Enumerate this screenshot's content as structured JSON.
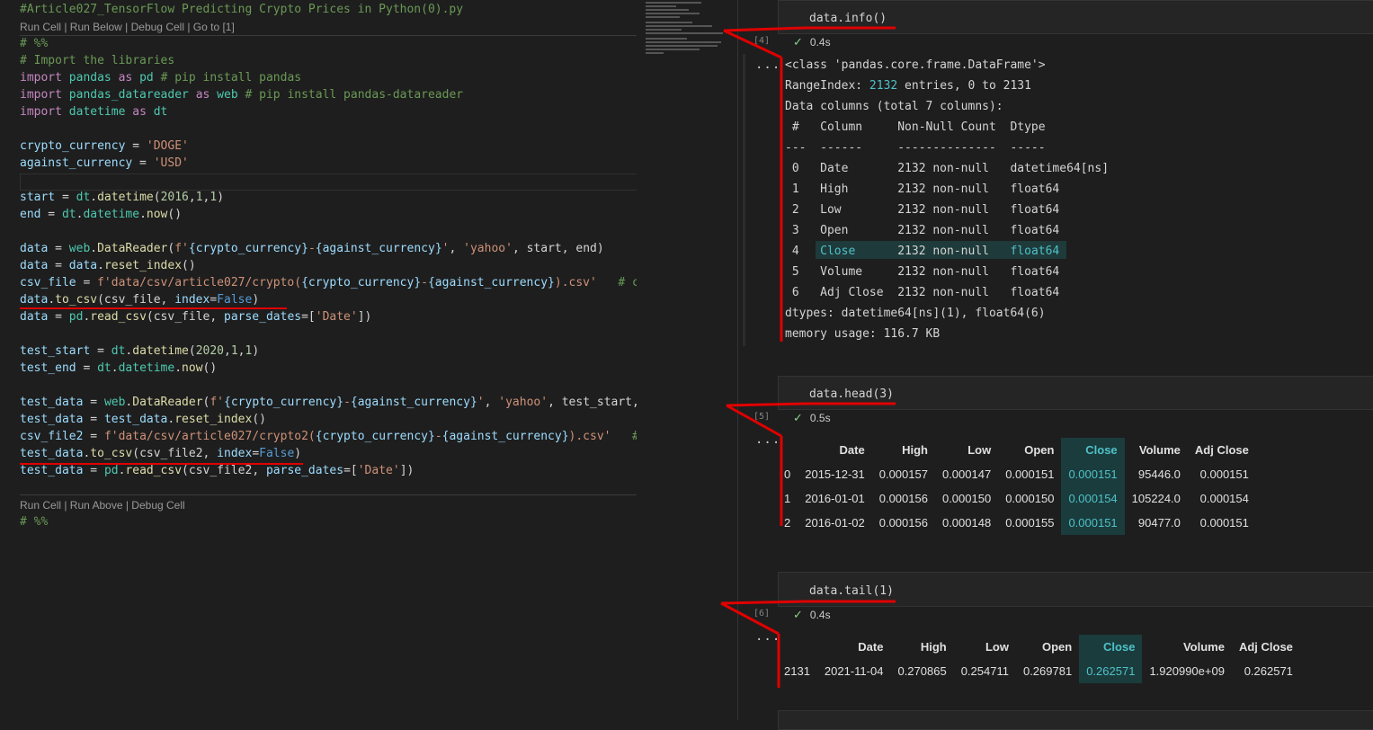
{
  "editor": {
    "title": "#Article027_TensorFlow Predicting Crypto Prices in Python(0).py",
    "codelens_top": "Run Cell | Run Below | Debug Cell | Go to [1]",
    "codelens_bottom": "Run Cell | Run Above | Debug Cell",
    "lines": {
      "l1": "# %%",
      "l2": "# Import the libraries",
      "l3a": "import",
      "l3b": " pandas ",
      "l3c": "as",
      "l3d": " pd ",
      "l3e": "# pip install pandas",
      "l4a": "import",
      "l4b": " pandas_datareader ",
      "l4c": "as",
      "l4d": " web ",
      "l4e": "# pip install pandas-datareader",
      "l5a": "import",
      "l5b": " datetime ",
      "l5c": "as",
      "l5d": " dt",
      "l6a": "crypto_currency",
      "l6b": " = ",
      "l6c": "'DOGE'",
      "l7a": "against_currency",
      "l7b": " = ",
      "l7c": "'USD'",
      "l8a": "start",
      "l8b": " = ",
      "l8c": "dt",
      "l8d": ".",
      "l8e": "datetime",
      "l8f": "(",
      "l8g": "2016",
      "l8h": ",",
      "l8i": "1",
      "l8j": ",",
      "l8k": "1",
      "l8l": ")",
      "l9a": "end",
      "l9b": " = ",
      "l9c": "dt",
      "l9d": ".",
      "l9e": "datetime",
      "l9f": ".",
      "l9g": "now",
      "l9h": "()",
      "l10a": "data",
      "l10b": " = ",
      "l10c": "web",
      "l10d": ".",
      "l10e": "DataReader",
      "l10f": "(",
      "l10g": "f'",
      "l10h": "{crypto_currency}",
      "l10i": "-",
      "l10j": "{against_currency}",
      "l10k": "'",
      "l10l": ", ",
      "l10m": "'yahoo'",
      "l10n": ", start, end)",
      "l11a": "data",
      "l11b": " = ",
      "l11c": "data",
      "l11d": ".",
      "l11e": "reset_index",
      "l11f": "()",
      "l12a": "csv_file",
      "l12b": " = ",
      "l12c": "f'data/csv/article027/crypto(",
      "l12d": "{crypto_currency}",
      "l12e": "-",
      "l12f": "{against_currency}",
      "l12g": ").csv'",
      "l12h": "   # cry",
      "l13a": "data",
      "l13b": ".",
      "l13c": "to_csv",
      "l13d": "(csv_file, ",
      "l13e": "index",
      "l13f": "=",
      "l13g": "False",
      "l13h": ")",
      "l14a": "data",
      "l14b": " = ",
      "l14c": "pd",
      "l14d": ".",
      "l14e": "read_csv",
      "l14f": "(csv_file, ",
      "l14g": "parse_dates",
      "l14h": "=[",
      "l14i": "'Date'",
      "l14j": "])",
      "l15a": "test_start",
      "l15b": " = ",
      "l15c": "dt",
      "l15d": ".",
      "l15e": "datetime",
      "l15f": "(",
      "l15g": "2020",
      "l15h": ",",
      "l15i": "1",
      "l15j": ",",
      "l15k": "1",
      "l15l": ")",
      "l16a": "test_end",
      "l16b": " = ",
      "l16c": "dt",
      "l16d": ".",
      "l16e": "datetime",
      "l16f": ".",
      "l16g": "now",
      "l16h": "()",
      "l17a": "test_data",
      "l17b": " = ",
      "l17c": "web",
      "l17d": ".",
      "l17e": "DataReader",
      "l17f": "(",
      "l17g": "f'",
      "l17h": "{crypto_currency}",
      "l17i": "-",
      "l17j": "{against_currency}",
      "l17k": "'",
      "l17l": ", ",
      "l17m": "'yahoo'",
      "l17n": ", test_start, t",
      "l18a": "test_data",
      "l18b": " = ",
      "l18c": "test_data",
      "l18d": ".",
      "l18e": "reset_index",
      "l18f": "()",
      "l19a": "csv_file2",
      "l19b": " = ",
      "l19c": "f'data/csv/article027/crypto2(",
      "l19d": "{crypto_currency}",
      "l19e": "-",
      "l19f": "{against_currency}",
      "l19g": ").csv'",
      "l19h": "   # c",
      "l20a": "test_data",
      "l20b": ".",
      "l20c": "to_csv",
      "l20d": "(csv_file2, ",
      "l20e": "index",
      "l20f": "=",
      "l20g": "False",
      "l20h": ")",
      "l21a": "test_data",
      "l21b": " = ",
      "l21c": "pd",
      "l21d": ".",
      "l21e": "read_csv",
      "l21f": "(csv_file2, ",
      "l21g": "parse_dates",
      "l21h": "=[",
      "l21i": "'Date'",
      "l21j": "])",
      "l22": "# %%"
    }
  },
  "notebook": {
    "cell4": {
      "code": "data.info()",
      "exec": "[4]",
      "time": "0.4s",
      "more": "...",
      "info": {
        "class_line": "<class 'pandas.core.frame.DataFrame'>",
        "range_a": "RangeIndex: ",
        "range_b": "2132",
        "range_c": " entries, 0 to 2131",
        "cols_line": "Data columns (total 7 columns):",
        "hdr_line": " #   Column     Non-Null Count  Dtype",
        "dash_line": "---  ------     --------------  -----",
        "r0": " 0   Date       2132 non-null   datetime64[ns]",
        "r1": " 1   High       2132 non-null   float64",
        "r2": " 2   Low        2132 non-null   float64",
        "r3": " 3   Open       2132 non-null   float64",
        "r4a": " 4   ",
        "r4b": "Close",
        "r4c": "      2132 non-null   ",
        "r4d": "float64",
        "r5": " 5   Volume     2132 non-null   float64",
        "r6": " 6   Adj Close  2132 non-null   float64",
        "dtypes": "dtypes: datetime64[ns](1), float64(6)",
        "memory": "memory usage: 116.7 KB"
      }
    },
    "cell5": {
      "code": "data.head(3)",
      "exec": "[5]",
      "time": "0.5s",
      "more": "...",
      "columns": [
        "",
        "Date",
        "High",
        "Low",
        "Open",
        "Close",
        "Volume",
        "Adj Close"
      ],
      "rows": [
        [
          "0",
          "2015-12-31",
          "0.000157",
          "0.000147",
          "0.000151",
          "0.000151",
          "95446.0",
          "0.000151"
        ],
        [
          "1",
          "2016-01-01",
          "0.000156",
          "0.000150",
          "0.000150",
          "0.000154",
          "105224.0",
          "0.000154"
        ],
        [
          "2",
          "2016-01-02",
          "0.000156",
          "0.000148",
          "0.000155",
          "0.000151",
          "90477.0",
          "0.000151"
        ]
      ]
    },
    "cell6": {
      "code": "data.tail(1)",
      "exec": "[6]",
      "time": "0.4s",
      "more": "...",
      "columns": [
        "",
        "Date",
        "High",
        "Low",
        "Open",
        "Close",
        "Volume",
        "Adj Close"
      ],
      "rows": [
        [
          "2131",
          "2021-11-04",
          "0.270865",
          "0.254711",
          "0.269781",
          "0.262571",
          "1.920990e+09",
          "0.262571"
        ]
      ]
    }
  },
  "colors": {
    "annotation": "#e00000",
    "highlight": "#4fc1c9"
  },
  "icons": {
    "check": "check-icon"
  }
}
